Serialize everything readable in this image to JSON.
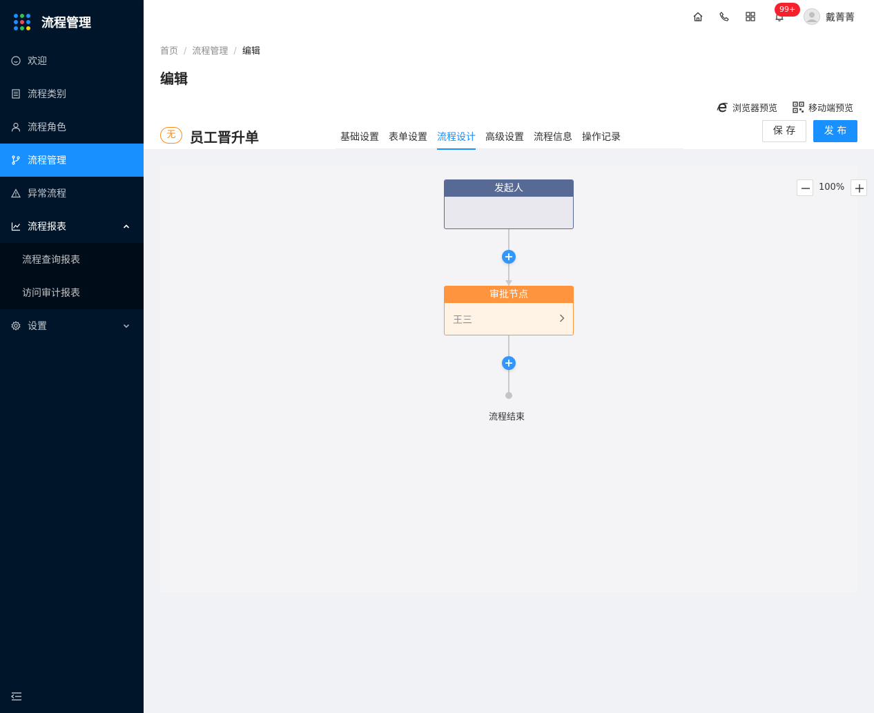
{
  "app": {
    "title": "流程管理"
  },
  "sidebar": {
    "items": [
      {
        "label": "欢迎",
        "icon": "smile-icon"
      },
      {
        "label": "流程类别",
        "icon": "list-icon"
      },
      {
        "label": "流程角色",
        "icon": "user-icon"
      },
      {
        "label": "流程管理",
        "icon": "branch-icon",
        "active": true
      },
      {
        "label": "异常流程",
        "icon": "warning-icon"
      },
      {
        "label": "流程报表",
        "icon": "line-chart-icon",
        "expanded": true
      },
      {
        "label": "设置",
        "icon": "setting-icon"
      }
    ],
    "submenu": [
      "流程查询报表",
      "访问审计报表"
    ]
  },
  "header": {
    "notification_count": "99+",
    "username": "戴菁菁"
  },
  "breadcrumb": [
    "首页",
    "流程管理",
    "编辑"
  ],
  "page": {
    "title": "编辑",
    "browser_preview": "浏览器预览",
    "mobile_preview": "移动端预览",
    "status_tag": "无",
    "form_name": "员工晋升单",
    "tabs": [
      "基础设置",
      "表单设置",
      "流程设计",
      "高级设置",
      "流程信息",
      "操作记录"
    ],
    "active_tab": "流程设计",
    "save_label": "保 存",
    "publish_label": "发 布"
  },
  "canvas": {
    "zoom": "100%",
    "start_node": {
      "title": "发起人",
      "content": ""
    },
    "approve_node": {
      "title": "审批节点",
      "content": "王三"
    },
    "end_label": "流程结束"
  },
  "colors": {
    "sidebar_bg": "#001529",
    "primary": "#1890ff",
    "start_node": "#576a95",
    "approve_node": "#ff943e",
    "badge": "#f5222d"
  }
}
